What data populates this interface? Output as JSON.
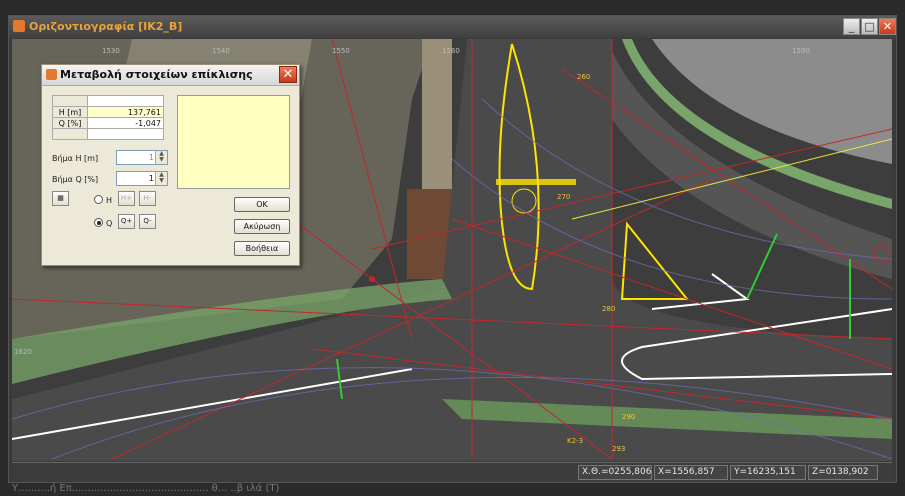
{
  "window": {
    "title": "Οριζοντιογραφία [IK2_B]"
  },
  "dialog": {
    "title": "Μεταβολή στοιχείων επίκλισης",
    "grid": {
      "rows": [
        {
          "label": "H [m]",
          "value": "137,761"
        },
        {
          "label": "Q [%]",
          "value": "-1,047"
        }
      ]
    },
    "step_h_label": "Βήμα H [m]",
    "step_h_value": "1",
    "step_q_label": "Βήμα Q [%]",
    "step_q_value": "1",
    "radio_h_label": "H",
    "radio_q_label": "Q",
    "q_plus_label": "Q+",
    "q_minus_label": "Q-",
    "h_plus_label": "H+",
    "h_minus_label": "H-",
    "ok_label": "OK",
    "cancel_label": "Ακύρωση",
    "help_label": "Βοήθεια"
  },
  "map": {
    "ticks": [
      "1530",
      "1540",
      "1550",
      "1560",
      "1590",
      "1620"
    ],
    "stations": [
      "260",
      "270",
      "280",
      "290",
      "293"
    ],
    "marker": "K2-3"
  },
  "status": {
    "xtheta": "X.Θ.=0255,806",
    "x": "X=1556,857",
    "y": "Y=16235,151",
    "z": "Z=0138,902"
  },
  "footer": {
    "text": "Υ..........ή Επ........................................... θ... ..β ιλά (Τ)"
  }
}
